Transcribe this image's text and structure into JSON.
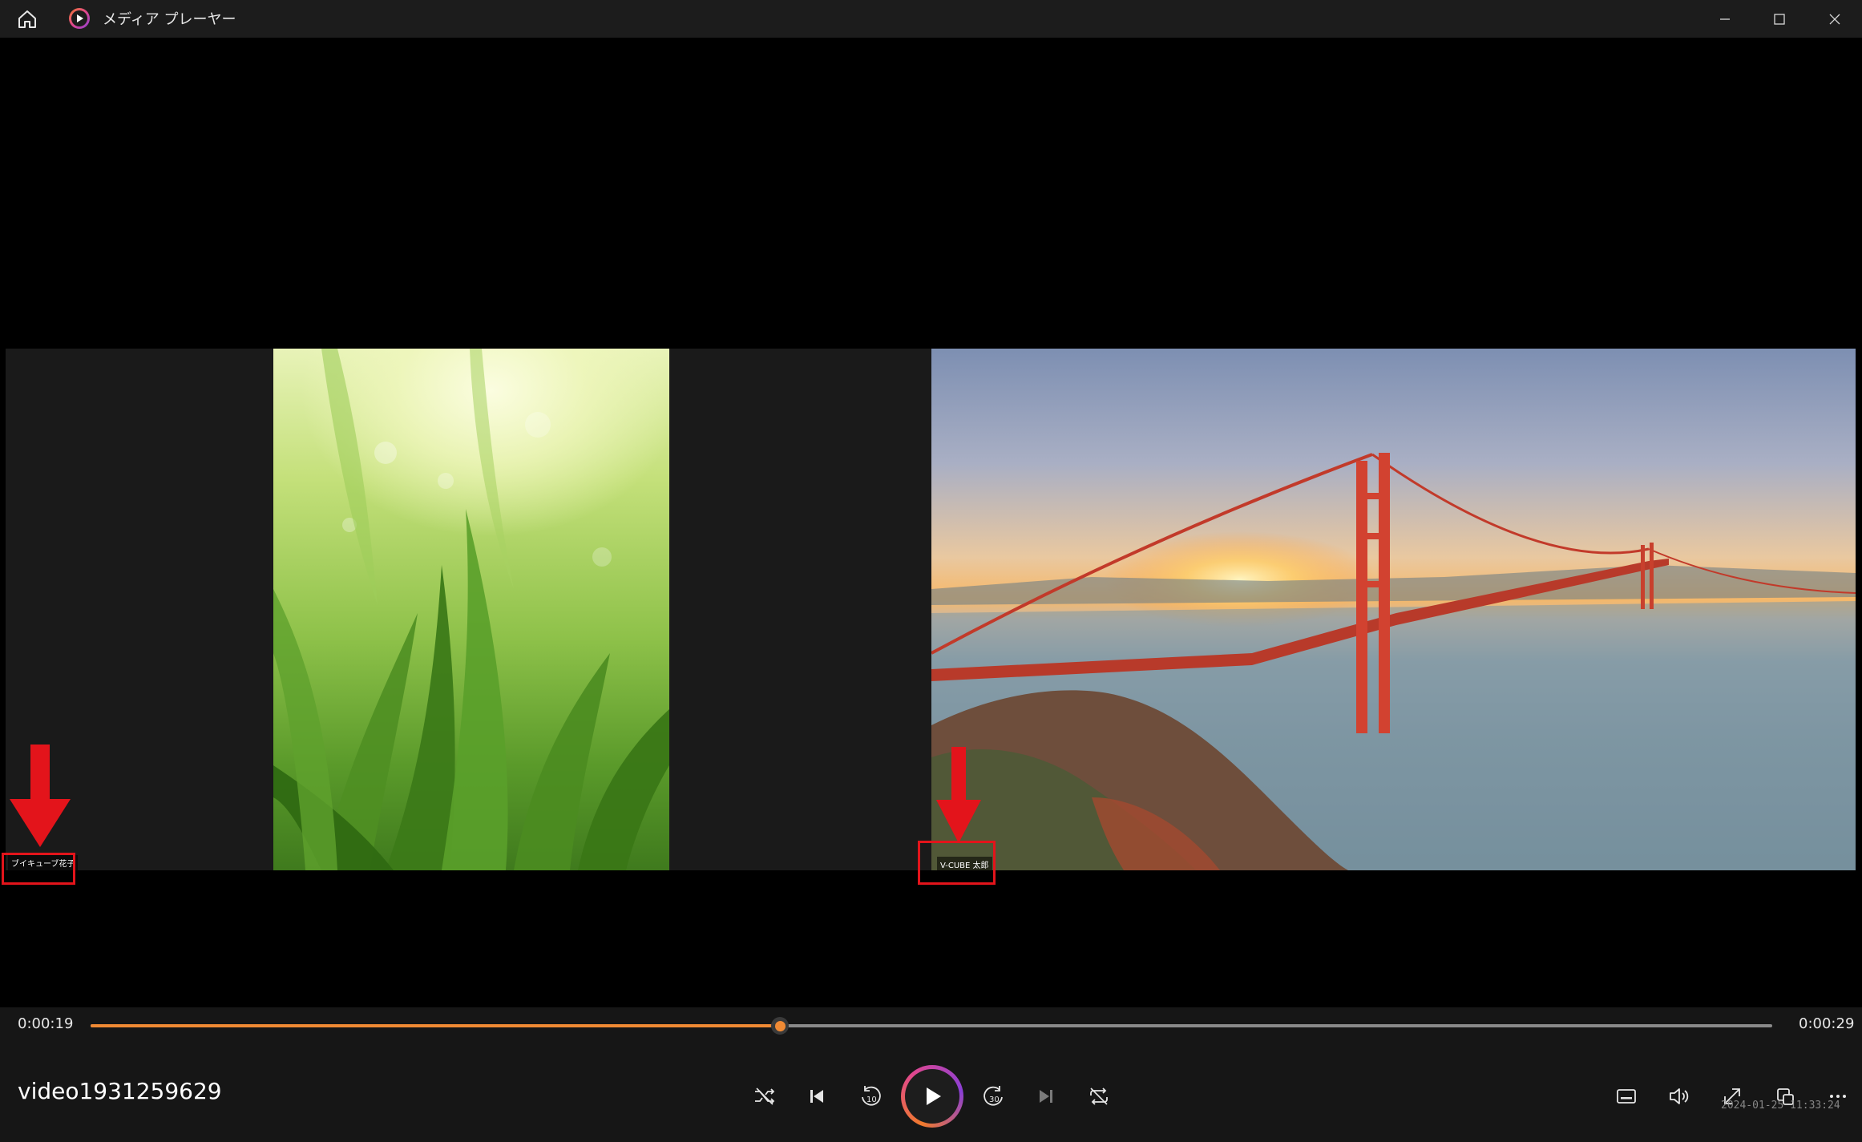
{
  "window": {
    "title": "メディア プレーヤー"
  },
  "video": {
    "participants": [
      {
        "name": "ブイキューブ花子"
      },
      {
        "name": "V-CUBE 太郎"
      }
    ],
    "overlay_timestamp": "2024-01-25 11:33:24"
  },
  "playback": {
    "current_time": "0:00:19",
    "total_time": "0:00:29",
    "progress_fraction": 0.41,
    "media_title": "video1931259629",
    "state": "paused"
  },
  "colors": {
    "accent": "#f08a34",
    "annotation_red": "#e3141b",
    "control_bar_bg": "#161616",
    "titlebar_bg": "#1c1c1c"
  },
  "icons": [
    "home-icon",
    "media-player-app-icon",
    "minimize-icon",
    "maximize-icon",
    "close-icon",
    "shuffle-icon",
    "previous-icon",
    "rewind-10-icon",
    "play-icon",
    "forward-30-icon",
    "next-icon",
    "repeat-off-icon",
    "subtitles-icon",
    "volume-icon",
    "fullscreen-icon",
    "miniplayer-icon",
    "more-icon"
  ]
}
